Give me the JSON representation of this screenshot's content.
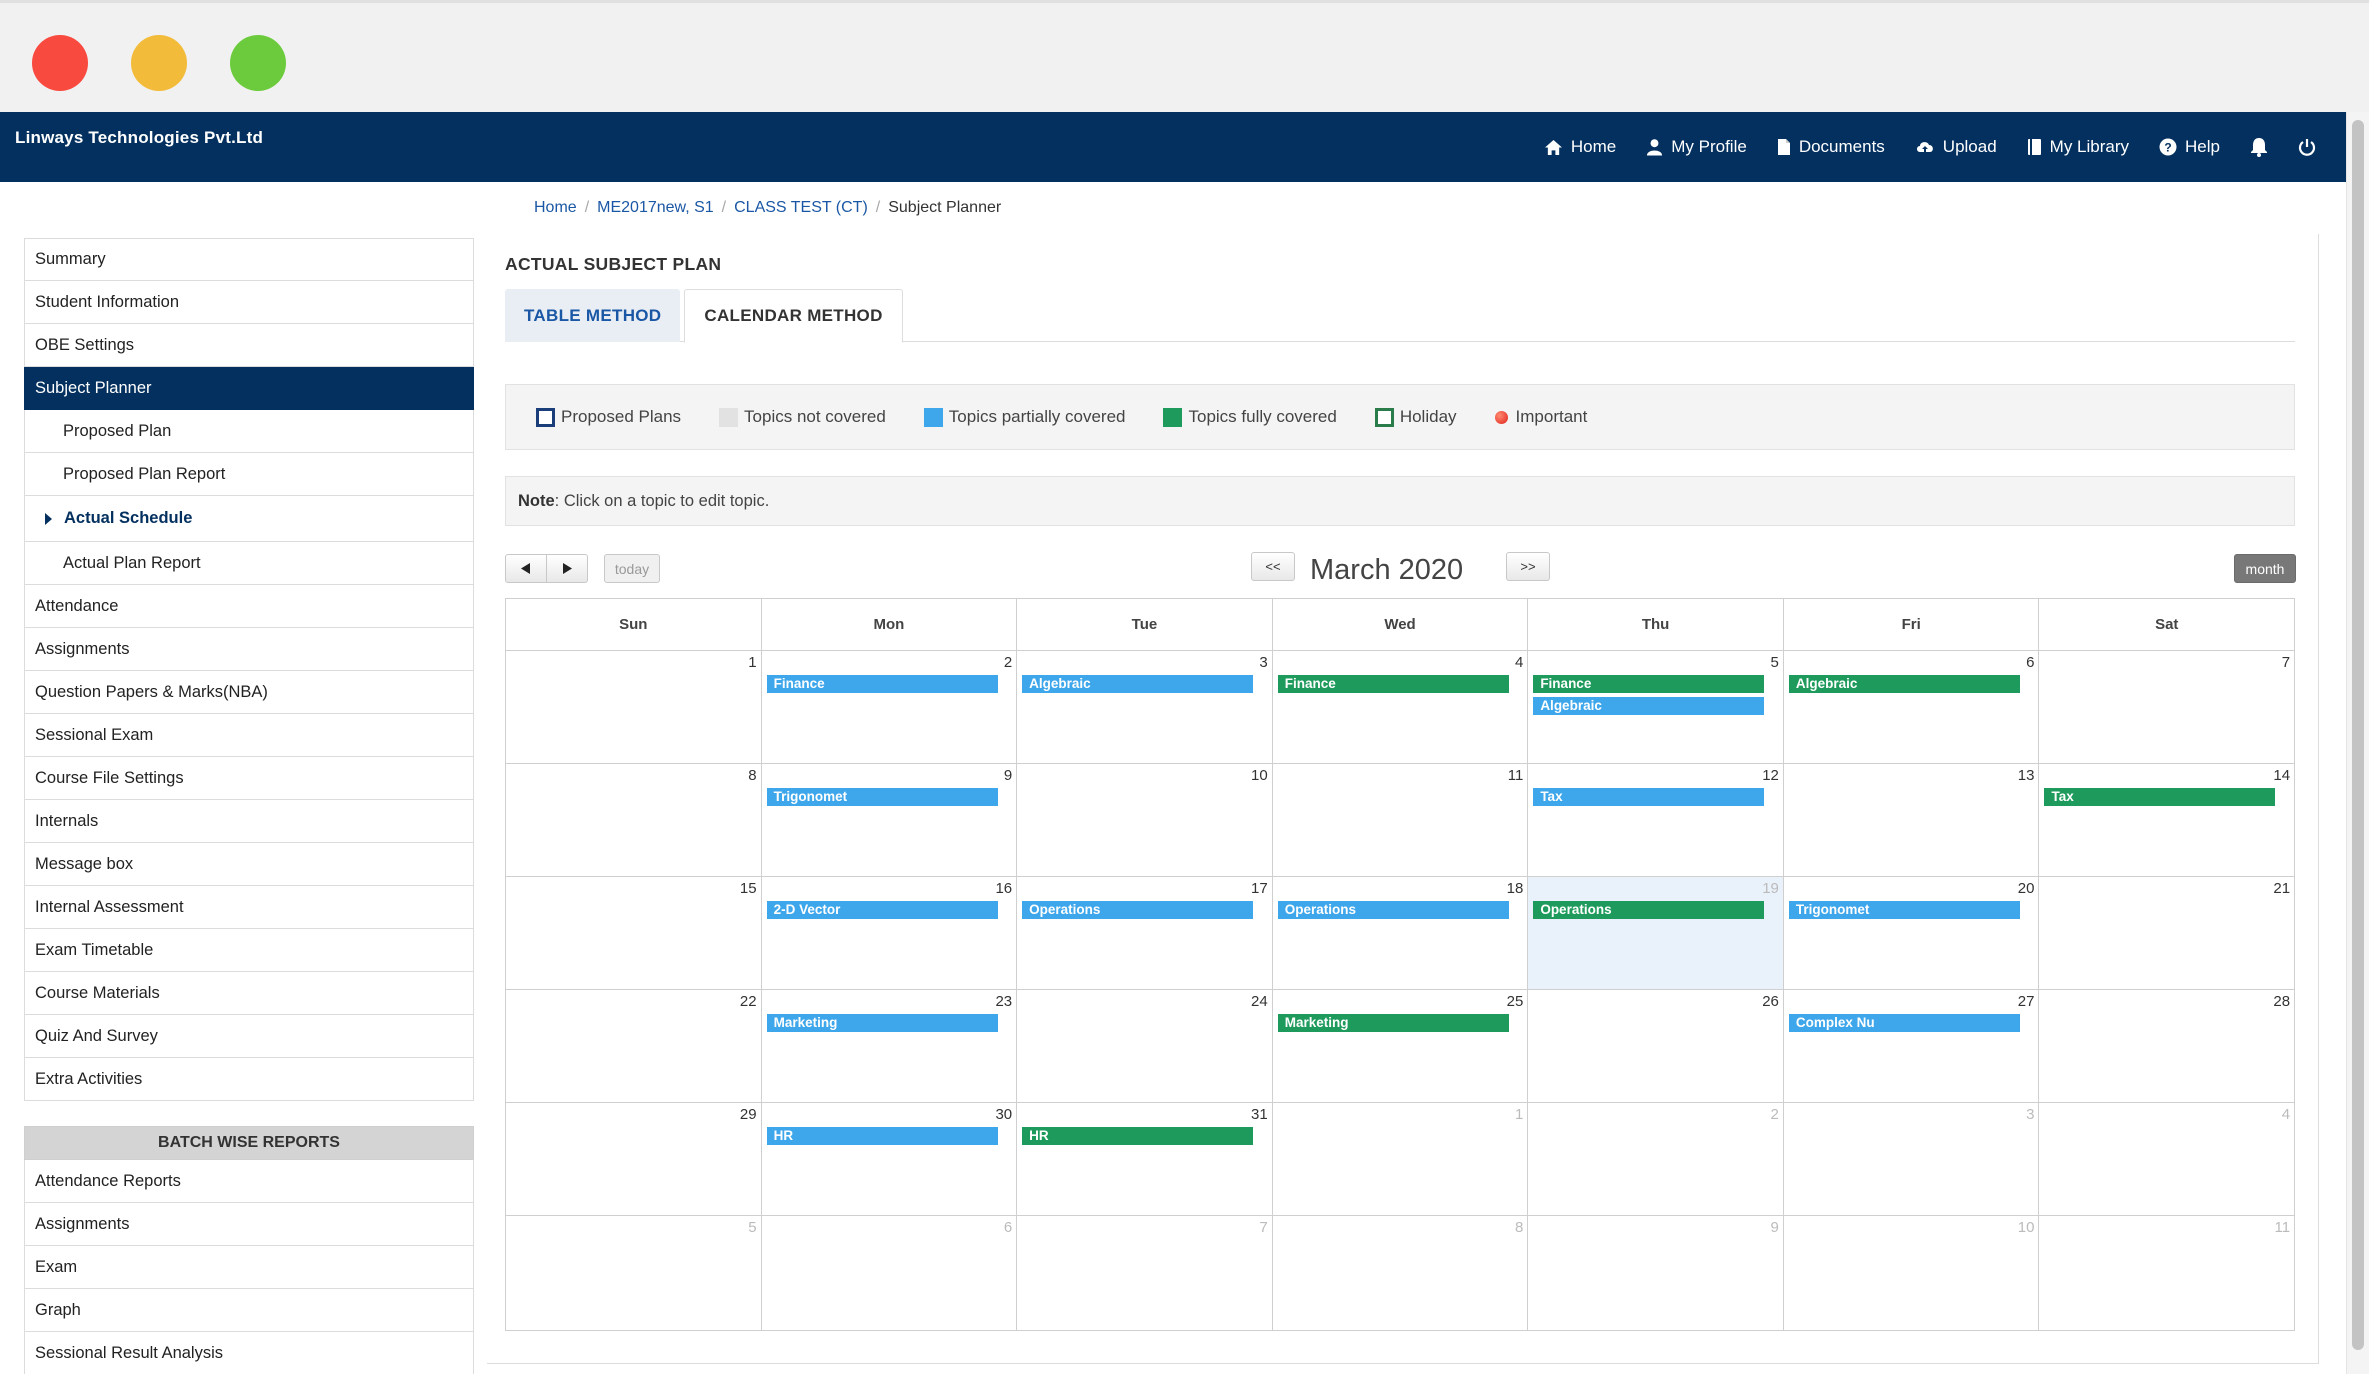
{
  "navbar": {
    "brand": "Linways Technologies Pvt.Ltd",
    "links": {
      "home": "Home",
      "profile": "My Profile",
      "documents": "Documents",
      "upload": "Upload",
      "library": "My Library",
      "help": "Help"
    }
  },
  "breadcrumb": [
    "Home",
    "ME2017new, S1",
    "CLASS TEST (CT)",
    "Subject Planner"
  ],
  "sidebar": {
    "items": [
      {
        "label": "Summary"
      },
      {
        "label": "Student Information"
      },
      {
        "label": "OBE Settings"
      },
      {
        "label": "Subject Planner"
      },
      {
        "label": "Proposed Plan"
      },
      {
        "label": "Proposed Plan Report"
      },
      {
        "label": "Actual Schedule"
      },
      {
        "label": "Actual Plan Report"
      },
      {
        "label": "Attendance"
      },
      {
        "label": "Assignments"
      },
      {
        "label": "Question Papers & Marks(NBA)"
      },
      {
        "label": "Sessional Exam"
      },
      {
        "label": "Course File Settings"
      },
      {
        "label": "Internals"
      },
      {
        "label": "Message box"
      },
      {
        "label": "Internal Assessment"
      },
      {
        "label": "Exam Timetable"
      },
      {
        "label": "Course Materials"
      },
      {
        "label": "Quiz And Survey"
      },
      {
        "label": "Extra Activities"
      }
    ],
    "batch_heading": "BATCH WISE REPORTS",
    "batch_items": [
      {
        "label": "Attendance Reports"
      },
      {
        "label": "Assignments"
      },
      {
        "label": "Exam"
      },
      {
        "label": "Graph"
      },
      {
        "label": "Sessional Result Analysis"
      }
    ]
  },
  "main": {
    "title": "ACTUAL SUBJECT PLAN",
    "tabs": {
      "table": "TABLE METHOD",
      "calendar": "CALENDAR METHOD"
    },
    "legend": {
      "proposed": "Proposed Plans",
      "not_covered": "Topics not covered",
      "partial": "Topics partially covered",
      "full": "Topics fully covered",
      "holiday": "Holiday",
      "important": "Important"
    },
    "note_label": "Note",
    "note_text": ": Click on a topic to edit topic.",
    "colors": {
      "navbar": "#03305f",
      "partial": "#3ea6ea",
      "full": "#1e9b5c"
    }
  },
  "calendar": {
    "title": "March 2020",
    "today_label": "today",
    "prev_year": "<<",
    "next_year": ">>",
    "month_label": "month",
    "weekdays": [
      "Sun",
      "Mon",
      "Tue",
      "Wed",
      "Thu",
      "Fri",
      "Sat"
    ],
    "weeks": [
      [
        {
          "day": "1",
          "events": []
        },
        {
          "day": "2",
          "events": [
            {
              "title": "Finance",
              "status": "partial"
            }
          ]
        },
        {
          "day": "3",
          "events": [
            {
              "title": "Algebraic",
              "status": "partial"
            }
          ]
        },
        {
          "day": "4",
          "events": [
            {
              "title": "Finance",
              "status": "full"
            }
          ]
        },
        {
          "day": "5",
          "events": [
            {
              "title": "Finance",
              "status": "full"
            },
            {
              "title": "Algebraic",
              "status": "partial"
            }
          ]
        },
        {
          "day": "6",
          "events": [
            {
              "title": "Algebraic",
              "status": "full"
            }
          ]
        },
        {
          "day": "7",
          "events": []
        }
      ],
      [
        {
          "day": "8",
          "events": []
        },
        {
          "day": "9",
          "events": [
            {
              "title": "Trigonomet",
              "status": "partial"
            }
          ]
        },
        {
          "day": "10",
          "events": []
        },
        {
          "day": "11",
          "events": []
        },
        {
          "day": "12",
          "events": [
            {
              "title": "Tax",
              "status": "partial"
            }
          ]
        },
        {
          "day": "13",
          "events": []
        },
        {
          "day": "14",
          "events": [
            {
              "title": "Tax",
              "status": "full"
            }
          ]
        }
      ],
      [
        {
          "day": "15",
          "events": []
        },
        {
          "day": "16",
          "events": [
            {
              "title": "2-D Vector",
              "status": "partial"
            }
          ]
        },
        {
          "day": "17",
          "events": [
            {
              "title": "Operations",
              "status": "partial"
            }
          ]
        },
        {
          "day": "18",
          "events": [
            {
              "title": "Operations",
              "status": "partial"
            }
          ]
        },
        {
          "day": "19",
          "today": true,
          "events": [
            {
              "title": "Operations",
              "status": "full"
            }
          ]
        },
        {
          "day": "20",
          "events": [
            {
              "title": "Trigonomet",
              "status": "partial"
            }
          ]
        },
        {
          "day": "21",
          "events": []
        }
      ],
      [
        {
          "day": "22",
          "events": []
        },
        {
          "day": "23",
          "events": [
            {
              "title": "Marketing",
              "status": "partial"
            }
          ]
        },
        {
          "day": "24",
          "events": []
        },
        {
          "day": "25",
          "events": [
            {
              "title": "Marketing",
              "status": "full"
            }
          ]
        },
        {
          "day": "26",
          "events": []
        },
        {
          "day": "27",
          "events": [
            {
              "title": "Complex Nu",
              "status": "partial"
            }
          ]
        },
        {
          "day": "28",
          "events": []
        }
      ],
      [
        {
          "day": "29",
          "events": []
        },
        {
          "day": "30",
          "events": [
            {
              "title": "HR",
              "status": "partial"
            }
          ]
        },
        {
          "day": "31",
          "events": [
            {
              "title": "HR",
              "status": "full"
            }
          ]
        },
        {
          "day": "1",
          "other": true,
          "events": []
        },
        {
          "day": "2",
          "other": true,
          "events": []
        },
        {
          "day": "3",
          "other": true,
          "events": []
        },
        {
          "day": "4",
          "other": true,
          "events": []
        }
      ],
      [
        {
          "day": "5",
          "other": true,
          "events": []
        },
        {
          "day": "6",
          "other": true,
          "events": []
        },
        {
          "day": "7",
          "other": true,
          "events": []
        },
        {
          "day": "8",
          "other": true,
          "events": []
        },
        {
          "day": "9",
          "other": true,
          "events": []
        },
        {
          "day": "10",
          "other": true,
          "events": []
        },
        {
          "day": "11",
          "other": true,
          "events": []
        }
      ]
    ]
  }
}
